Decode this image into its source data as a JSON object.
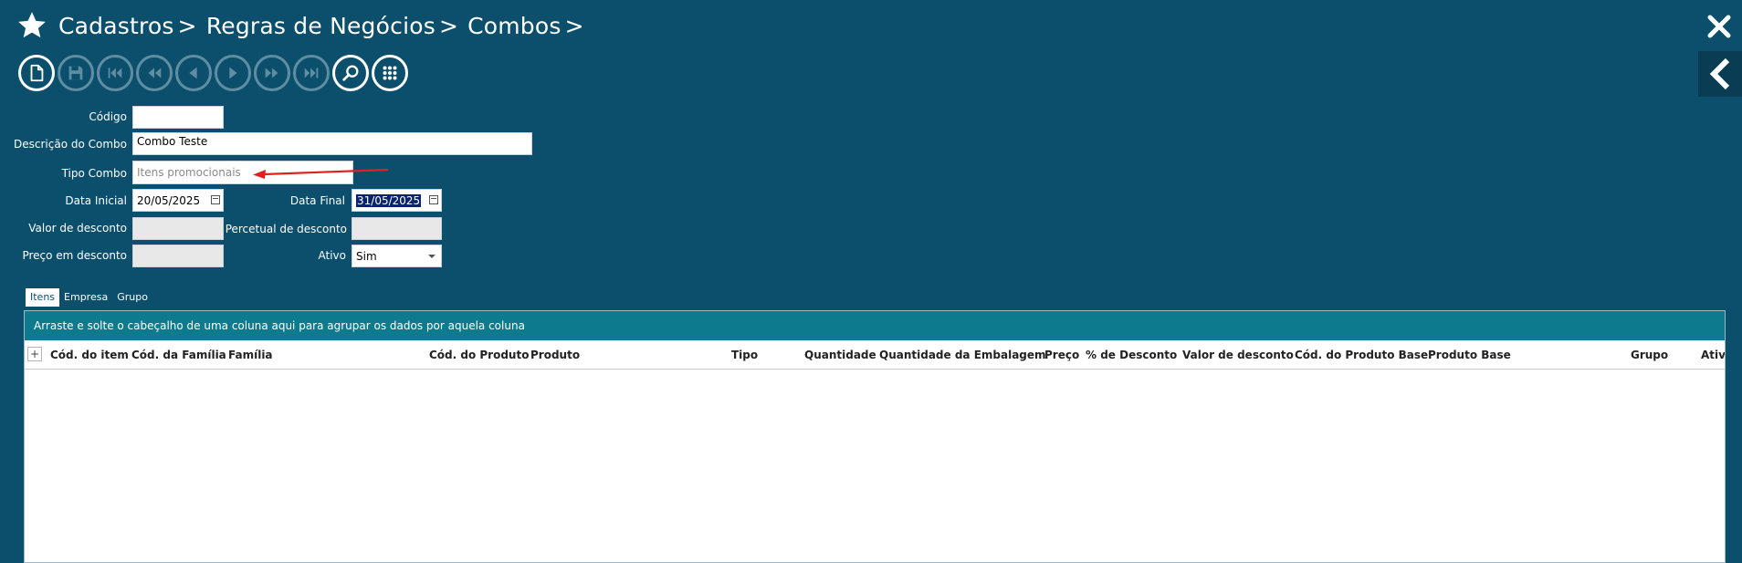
{
  "breadcrumb": [
    "Cadastros",
    "Regras de Negócios",
    "Combos"
  ],
  "breadcrumb_sep": ">",
  "toolbar": [
    {
      "icon": "new-file-icon",
      "enabled": true
    },
    {
      "icon": "save-icon",
      "enabled": false
    },
    {
      "icon": "first-record-icon",
      "enabled": false
    },
    {
      "icon": "fast-back-icon",
      "enabled": false
    },
    {
      "icon": "previous-icon",
      "enabled": false
    },
    {
      "icon": "next-icon",
      "enabled": false
    },
    {
      "icon": "fast-forward-icon",
      "enabled": false
    },
    {
      "icon": "last-record-icon",
      "enabled": false
    },
    {
      "icon": "search-icon",
      "enabled": true
    },
    {
      "icon": "grid-menu-icon",
      "enabled": true
    }
  ],
  "form": {
    "codigo_label": "Código",
    "codigo_value": "",
    "descricao_label": "Descrição do Combo",
    "descricao_value": "Combo Teste",
    "tipo_label": "Tipo Combo",
    "tipo_placeholder": "Itens promocionais",
    "data_inicial_label": "Data Inicial",
    "data_inicial_value": "20/05/2025",
    "data_final_label": "Data Final",
    "data_final_value": "31/05/2025",
    "valor_desconto_label": "Valor de desconto",
    "percentual_label": "Percetual de desconto",
    "preco_desconto_label": "Preço em desconto",
    "ativo_label": "Ativo",
    "ativo_value": "Sim"
  },
  "tabs": [
    "Itens",
    "Empresa",
    "Grupo"
  ],
  "grid": {
    "group_hint": "Arraste e solte o cabeçalho de uma coluna aqui para agrupar os dados por aquela coluna",
    "expand_glyph": "+",
    "columns": [
      "Cód. do item",
      "Cód. da Família",
      "Família",
      "Cód. do Produto",
      "Produto",
      "Tipo",
      "Quantidade",
      "Quantidade da Embalagem",
      "Preço",
      "% de Desconto",
      "Valor de desconto",
      "Cód. do Produto Base",
      "Produto Base",
      "Grupo",
      "Ativo"
    ],
    "rows": []
  },
  "colors": {
    "background": "#0b4f6c",
    "group_panel": "#0e7a8e",
    "annotation_arrow": "#e02020"
  }
}
